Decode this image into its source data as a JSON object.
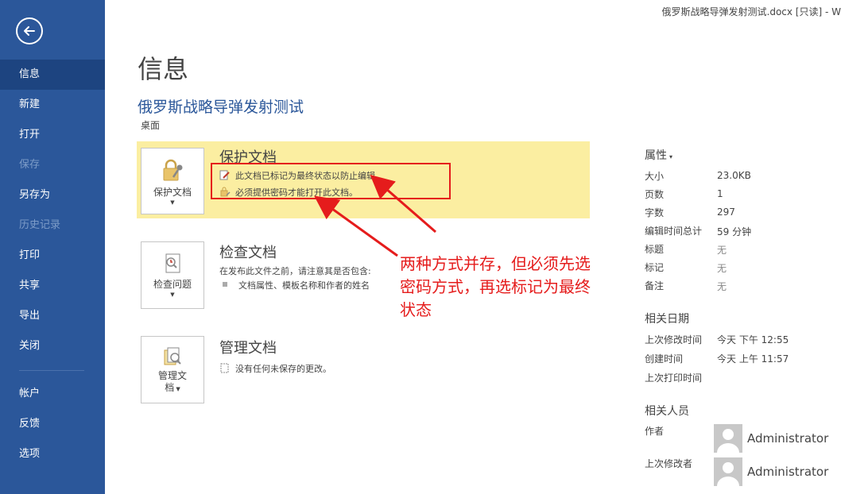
{
  "window": {
    "title": "俄罗斯战略导弹发射测试.docx [只读] - W"
  },
  "sidebar": {
    "back_icon": "back-arrow-icon",
    "items": [
      {
        "label": "信息",
        "state": "active"
      },
      {
        "label": "新建",
        "state": "normal"
      },
      {
        "label": "打开",
        "state": "normal"
      },
      {
        "label": "保存",
        "state": "disabled"
      },
      {
        "label": "另存为",
        "state": "normal"
      },
      {
        "label": "历史记录",
        "state": "disabled"
      },
      {
        "label": "打印",
        "state": "normal"
      },
      {
        "label": "共享",
        "state": "normal"
      },
      {
        "label": "导出",
        "state": "normal"
      },
      {
        "label": "关闭",
        "state": "normal"
      },
      {
        "label": "帐户",
        "state": "normal"
      },
      {
        "label": "反馈",
        "state": "normal"
      },
      {
        "label": "选项",
        "state": "normal"
      }
    ]
  },
  "main": {
    "page_title": "信息",
    "doc_title": "俄罗斯战略导弹发射测试",
    "doc_location": "桌面",
    "protect": {
      "button_label": "保护文档",
      "heading": "保护文档",
      "lines": [
        "此文档已标记为最终状态以防止编辑。",
        "必须提供密码才能打开此文档。"
      ]
    },
    "inspect": {
      "button_label": "检查问题",
      "heading": "检查文档",
      "intro": "在发布此文件之前，请注意其是否包含:",
      "bullet": "文档属性、模板名称和作者的姓名"
    },
    "manage": {
      "button_label_1": "管理文",
      "button_label_2": "档",
      "heading": "管理文档",
      "line": "没有任何未保存的更改。"
    }
  },
  "annotation": {
    "text_line1": "两种方式并存，但必须先选",
    "text_line2": "密码方式，再选标记为最终",
    "text_line3": "状态",
    "color": "#e51c1c"
  },
  "properties": {
    "heading": "属性",
    "items": [
      {
        "key": "大小",
        "value": "23.0KB",
        "muted": false
      },
      {
        "key": "页数",
        "value": "1",
        "muted": false
      },
      {
        "key": "字数",
        "value": "297",
        "muted": false
      },
      {
        "key": "编辑时间总计",
        "value": "59 分钟",
        "muted": false
      },
      {
        "key": "标题",
        "value": "无",
        "muted": true
      },
      {
        "key": "标记",
        "value": "无",
        "muted": true
      },
      {
        "key": "备注",
        "value": "无",
        "muted": true
      }
    ],
    "dates_heading": "相关日期",
    "dates": [
      {
        "key": "上次修改时间",
        "value": "今天 下午 12:55"
      },
      {
        "key": "创建时间",
        "value": "今天 上午 11:57"
      },
      {
        "key": "上次打印时间",
        "value": ""
      }
    ],
    "people_heading": "相关人员",
    "author_label": "作者",
    "author_name": "Administrator",
    "last_modified_by_label": "上次修改者",
    "last_modified_by_name": "Administrator"
  },
  "colors": {
    "sidebar": "#2b579a",
    "sidebar_active": "#1d4480",
    "highlight": "#fbeea1",
    "accent_text": "#2b579a"
  }
}
